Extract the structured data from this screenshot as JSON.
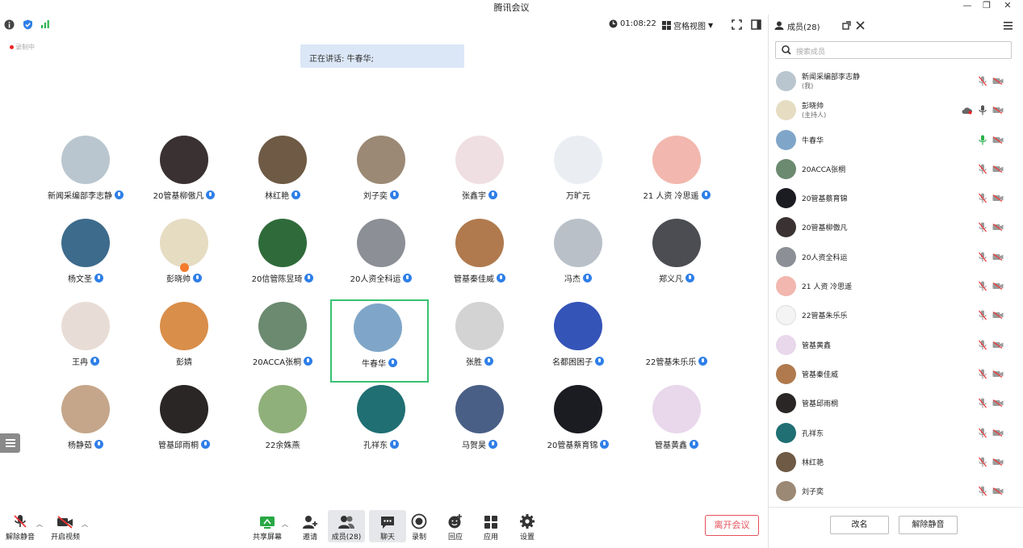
{
  "window": {
    "title": "腾讯会议"
  },
  "topbar": {
    "duration": "01:08:22",
    "view_mode": "宫格视图"
  },
  "recording_label": "录制中",
  "speaking_banner": "正在讲话: 牛春华;",
  "grid": [
    {
      "name": "新闻采编部李志静",
      "mic": true,
      "color": "#b9c6cf"
    },
    {
      "name": "20管基柳傲凡",
      "mic": true,
      "color": "#3a3232"
    },
    {
      "name": "林红艳",
      "mic": true,
      "color": "#6e5a45"
    },
    {
      "name": "刘子奕",
      "mic": true,
      "color": "#9b8975"
    },
    {
      "name": "张鑫宇",
      "mic": true,
      "color": "#f0dfe2"
    },
    {
      "name": "万旷元",
      "mic": false,
      "color": "#eaeef3"
    },
    {
      "name": "21 人资 冷思遥",
      "mic": true,
      "color": "#f2b7ae"
    },
    {
      "name": "杨文圣",
      "mic": true,
      "color": "#3d6b8c"
    },
    {
      "name": "彭晓帅",
      "mic": true,
      "host": true,
      "color": "#e6dcc2"
    },
    {
      "name": "20信管陈昱琦",
      "mic": true,
      "color": "#2f6b3a"
    },
    {
      "name": "20人资全科运",
      "mic": true,
      "color": "#8c8f95"
    },
    {
      "name": "管基秦佳威",
      "mic": true,
      "color": "#b07a4e"
    },
    {
      "name": "冯杰",
      "mic": true,
      "color": "#b9c0c8"
    },
    {
      "name": "郑义凡",
      "mic": true,
      "color": "#4b4d52"
    },
    {
      "name": "王冉",
      "mic": true,
      "color": "#e8ddd6"
    },
    {
      "name": "彭婧",
      "mic": false,
      "color": "#d98e4a"
    },
    {
      "name": "20ACCA张桐",
      "mic": true,
      "color": "#6b8a70"
    },
    {
      "name": "牛春华",
      "mic": true,
      "speaking": true,
      "color": "#7fa6c8"
    },
    {
      "name": "张胜",
      "mic": true,
      "color": "#d3d3d3"
    },
    {
      "name": "名都困困子",
      "mic": true,
      "color": "#3554b8"
    },
    {
      "name": "22管基朱乐乐",
      "mic": true,
      "color": "#ffffff"
    },
    {
      "name": "杨静茹",
      "mic": true,
      "color": "#c5a68a"
    },
    {
      "name": "管基邱雨桐",
      "mic": true,
      "color": "#2b2626"
    },
    {
      "name": "22余姝燕",
      "mic": false,
      "color": "#8fb07a"
    },
    {
      "name": "孔祥东",
      "mic": true,
      "color": "#1f6f73"
    },
    {
      "name": "马贺昊",
      "mic": true,
      "color": "#4a5f86"
    },
    {
      "name": "20管基蔡育锦",
      "mic": true,
      "color": "#1b1b22"
    },
    {
      "name": "管基黄鑫",
      "mic": true,
      "color": "#e9d7ec"
    }
  ],
  "bottombar": {
    "unmute": "解除静音",
    "start_video": "开启视频",
    "share_screen": "共享屏幕",
    "invite": "邀请",
    "members": "成员(28)",
    "chat": "聊天",
    "record": "录制",
    "react": "回应",
    "apps": "应用",
    "settings": "设置",
    "leave": "离开会议"
  },
  "panel": {
    "title": "成员(28)",
    "search_placeholder": "搜索成员",
    "members": [
      {
        "name": "新闻采编部李志静",
        "sub": "(我)",
        "mic": "muted",
        "color": "#b9c6cf"
      },
      {
        "name": "彭晓帅",
        "sub": "(主持人)",
        "mic": "on",
        "cloud": true,
        "color": "#e6dcc2"
      },
      {
        "name": "牛春华",
        "sub": "",
        "mic": "speaking",
        "color": "#7fa6c8"
      },
      {
        "name": "20ACCA张桐",
        "sub": "",
        "mic": "muted",
        "color": "#6b8a70"
      },
      {
        "name": "20管基蔡育锦",
        "sub": "",
        "mic": "muted",
        "color": "#1b1b22"
      },
      {
        "name": "20管基柳傲凡",
        "sub": "",
        "mic": "muted",
        "color": "#3a3232"
      },
      {
        "name": "20人资全科运",
        "sub": "",
        "mic": "muted",
        "color": "#8c8f95"
      },
      {
        "name": "21 人资 冷思遥",
        "sub": "",
        "mic": "muted",
        "color": "#f2b7ae"
      },
      {
        "name": "22管基朱乐乐",
        "sub": "",
        "mic": "muted",
        "color": "#f4f4f4"
      },
      {
        "name": "管基黄鑫",
        "sub": "",
        "mic": "muted",
        "color": "#e9d7ec"
      },
      {
        "name": "管基秦佳威",
        "sub": "",
        "mic": "muted",
        "color": "#b07a4e"
      },
      {
        "name": "管基邱雨桐",
        "sub": "",
        "mic": "muted",
        "color": "#2b2626"
      },
      {
        "name": "孔祥东",
        "sub": "",
        "mic": "muted",
        "color": "#1f6f73"
      },
      {
        "name": "林红艳",
        "sub": "",
        "mic": "muted",
        "color": "#6e5a45"
      },
      {
        "name": "刘子奕",
        "sub": "",
        "mic": "muted",
        "color": "#9b8975"
      }
    ],
    "rename_button": "改名",
    "unmute_all_button": "解除静音"
  }
}
